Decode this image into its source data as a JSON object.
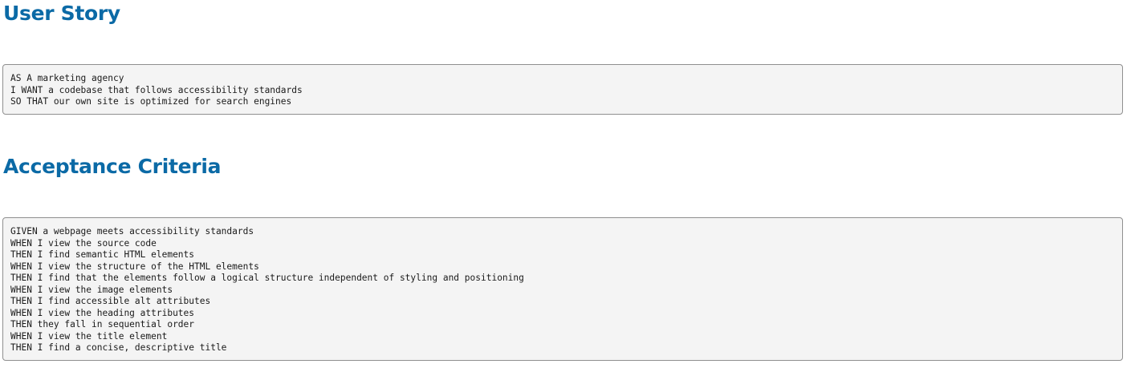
{
  "user_story": {
    "heading": "User Story",
    "lines": [
      "AS A marketing agency",
      "I WANT a codebase that follows accessibility standards",
      "SO THAT our own site is optimized for search engines"
    ]
  },
  "acceptance_criteria": {
    "heading": "Acceptance Criteria",
    "lines": [
      "GIVEN a webpage meets accessibility standards",
      "WHEN I view the source code",
      "THEN I find semantic HTML elements",
      "WHEN I view the structure of the HTML elements",
      "THEN I find that the elements follow a logical structure independent of styling and positioning",
      "WHEN I view the image elements",
      "THEN I find accessible alt attributes",
      "WHEN I view the heading attributes",
      "THEN they fall in sequential order",
      "WHEN I view the title element",
      "THEN I find a concise, descriptive title"
    ]
  }
}
